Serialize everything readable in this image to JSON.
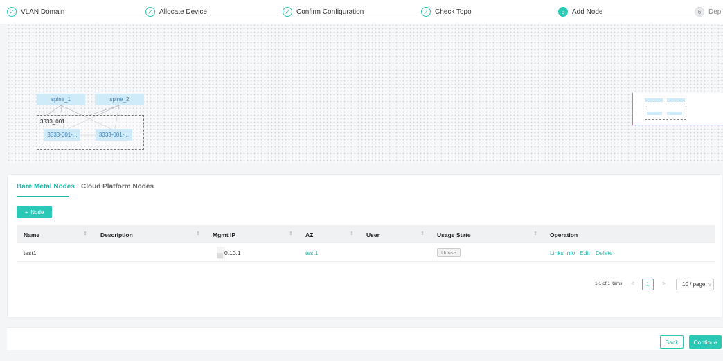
{
  "steps": [
    {
      "label": "VLAN Domain",
      "state": "done",
      "mark": "✓"
    },
    {
      "label": "Allocate Device",
      "state": "done",
      "mark": "✓"
    },
    {
      "label": "Confirm Configuration",
      "state": "done",
      "mark": "✓"
    },
    {
      "label": "Check Topo",
      "state": "done",
      "mark": "✓"
    },
    {
      "label": "Add Node",
      "state": "active",
      "mark": "5"
    },
    {
      "label": "Deplo",
      "state": "pending",
      "mark": "6"
    }
  ],
  "topology": {
    "spines": [
      "spine_1",
      "spine_2"
    ],
    "group_label": "3333_001",
    "leaves": [
      "3333-001-...",
      "3333-001-..."
    ]
  },
  "tabs": {
    "bare_metal": "Bare Metal Nodes",
    "cloud_platform": "Cloud Platform Nodes"
  },
  "toolbar": {
    "add_node_icon": "+",
    "add_node_label": "Node"
  },
  "table": {
    "columns": [
      "Name",
      "Description",
      "Mgmt IP",
      "AZ",
      "User",
      "Usage State",
      "Operation"
    ],
    "sort_glyph": "⇕",
    "rows": [
      {
        "name": "test1",
        "description": "",
        "mgmt_ip": "0.10.1",
        "az": "test1",
        "user": "",
        "usage_state": "Unuse",
        "operations": [
          "Links Info",
          "Edit",
          "Delete"
        ]
      }
    ]
  },
  "pagination": {
    "total": "1-1 of 1 items",
    "prev": "<",
    "next": ">",
    "current_page": "1",
    "page_size": "10 / page",
    "page_size_arrow": "∨"
  },
  "footer": {
    "back_label": "Back",
    "continue_label": "Continue"
  },
  "colors": {
    "accent": "#2bc8b6",
    "node_fill": "#cfeaf9"
  }
}
